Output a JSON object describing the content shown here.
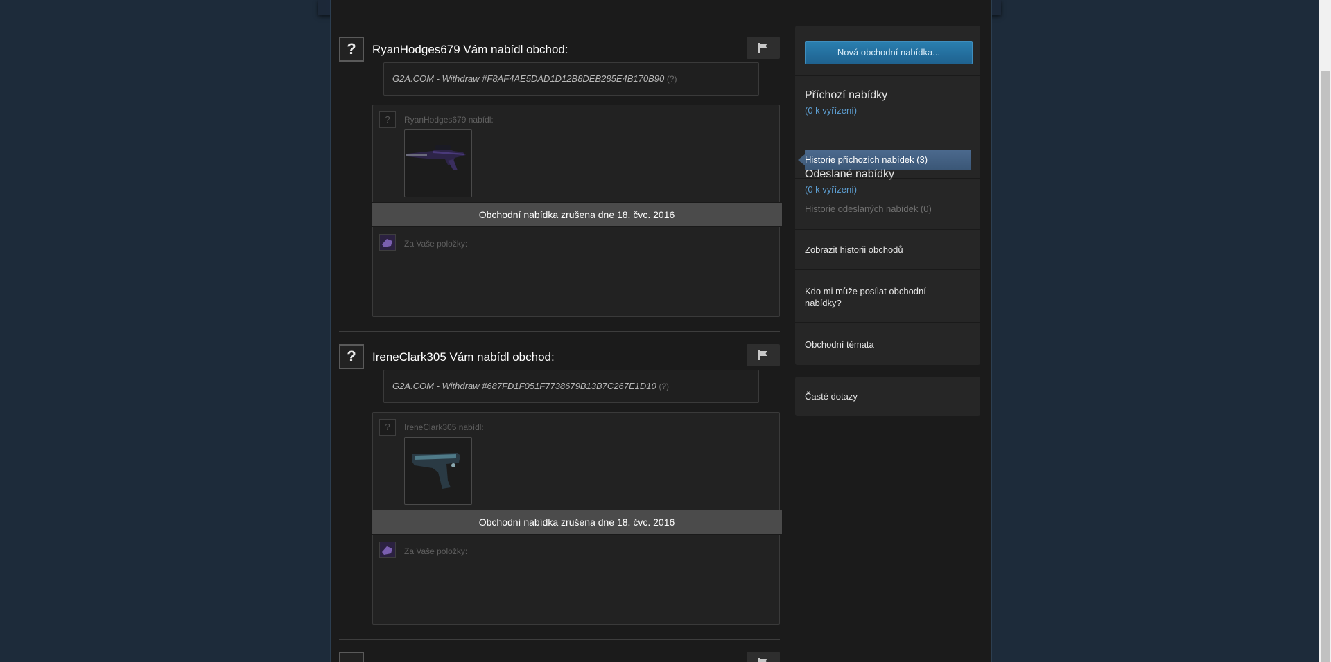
{
  "offers": [
    {
      "avatar_glyph": "?",
      "title": "RyanHodges679 Vám nabídl obchod:",
      "message": "G2A.COM - Withdraw #F8AF4AE5DAD1D12B8DEB285E4B170B90",
      "message_hint": "(?)",
      "partner_label": "RyanHodges679 nabídl:",
      "status": "Obchodní nabídka zrušena dne 18. čvc. 2016",
      "your_items_label": "Za Vaše položky:",
      "item": "sniper-rifle"
    },
    {
      "avatar_glyph": "?",
      "title": "IreneClark305 Vám nabídl obchod:",
      "message": "G2A.COM - Withdraw #687FD1F051F7738679B13B7C267E1D10",
      "message_hint": "(?)",
      "partner_label": "IreneClark305 nabídl:",
      "status": "Obchodní nabídka zrušena dne 18. čvc. 2016",
      "your_items_label": "Za Vaše položky:",
      "item": "pistol"
    }
  ],
  "sidebar": {
    "new_offer_button": "Nová obchodní nabídka...",
    "incoming": {
      "heading": "Příchozí nabídky",
      "pending": "(0 k vyřízení)",
      "history": "Historie příchozích nabídek (3)"
    },
    "sent": {
      "heading": "Odeslané nabídky",
      "pending": "(0 k vyřízení)",
      "history": "Historie odeslaných nabídek (0)"
    },
    "trade_history": "Zobrazit historii obchodů",
    "who_can_send": "Kdo mi může posílat obchodní nabídky?",
    "trade_topics": "Obchodní témata",
    "faq": "Časté dotazy"
  },
  "colors": {
    "page_bg": "#1d2b3a",
    "content_bg": "#1b1b1b",
    "accent_blue": "#2a7fb0",
    "pending_blue": "#5d9ed1"
  },
  "icons": {
    "flag": "flag-icon",
    "unknown_avatar": "question-mark-avatar"
  }
}
